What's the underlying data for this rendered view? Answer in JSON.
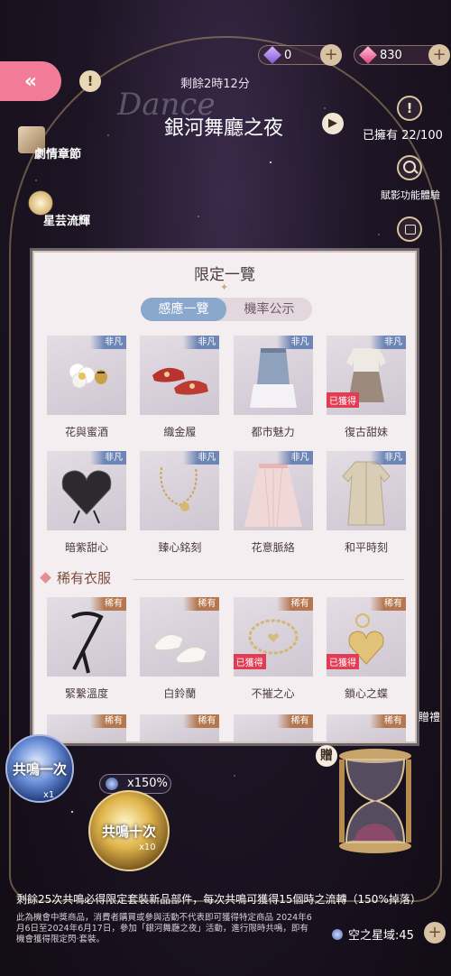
{
  "header": {
    "currency_purple": "0",
    "currency_pink": "830",
    "timer": "剩餘2時12分",
    "title_script": "Dance",
    "event_title": "銀河舞廳之夜",
    "owned": "已擁有 22/100",
    "preview_label": "賦影功能體驗"
  },
  "side": {
    "item1": "劇情章節",
    "item2": "星芸流輝"
  },
  "modal": {
    "title": "限定一覽",
    "tabs": [
      {
        "label": "感應一覽",
        "active": true
      },
      {
        "label": "機率公示",
        "active": false
      }
    ],
    "section_rare": "稀有衣服",
    "items_row1": [
      {
        "name": "花與蜜酒",
        "tag": "非凡",
        "obtained": ""
      },
      {
        "name": "織金履",
        "tag": "非凡",
        "obtained": ""
      },
      {
        "name": "都市魅力",
        "tag": "非凡",
        "obtained": ""
      },
      {
        "name": "復古甜妹",
        "tag": "非凡",
        "obtained": "已獲得"
      }
    ],
    "items_row2": [
      {
        "name": "暗紫甜心",
        "tag": "非凡",
        "obtained": ""
      },
      {
        "name": "臻心銘刻",
        "tag": "非凡",
        "obtained": ""
      },
      {
        "name": "花意脈絡",
        "tag": "非凡",
        "obtained": ""
      },
      {
        "name": "和平時刻",
        "tag": "非凡",
        "obtained": ""
      }
    ],
    "items_row3": [
      {
        "name": "緊繫溫度",
        "tag": "稀有",
        "obtained": ""
      },
      {
        "name": "白鈴蘭",
        "tag": "稀有",
        "obtained": ""
      },
      {
        "name": "不摧之心",
        "tag": "稀有",
        "obtained": "已獲得"
      },
      {
        "name": "鎖心之蝶",
        "tag": "稀有",
        "obtained": "已獲得"
      }
    ],
    "items_row4_tags": [
      "稀有",
      "稀有",
      "稀有",
      "稀有"
    ]
  },
  "bottom": {
    "pull_one": "共鳴一次",
    "pull_one_count": "x1",
    "pull_ten": "共鳴十次",
    "pull_ten_count": "x10",
    "rate": "x150%",
    "gift": "贈",
    "side_gift": "贈禮",
    "info_line": "剩餘25次共鳴必得限定套裝新品部件，每次共鳴可獲得15個時之流轉（150%掉落）",
    "fine_print": "此為機會中獎商品，消費者購買或參與活動不代表即可獲得特定商品 2024年6月6日至2024年6月17日，參加「銀河舞廳之夜」活動，進行限時共鳴，即有機會獲得限定閃‧套裝。",
    "stardust": "空之星域:45"
  },
  "colors": {
    "accent_pink": "#f27c97",
    "tab_active": "#8aa8cc",
    "tag_epic": "#6e86b6",
    "tag_rare": "#b4774e",
    "obtained": "#e23c55"
  }
}
